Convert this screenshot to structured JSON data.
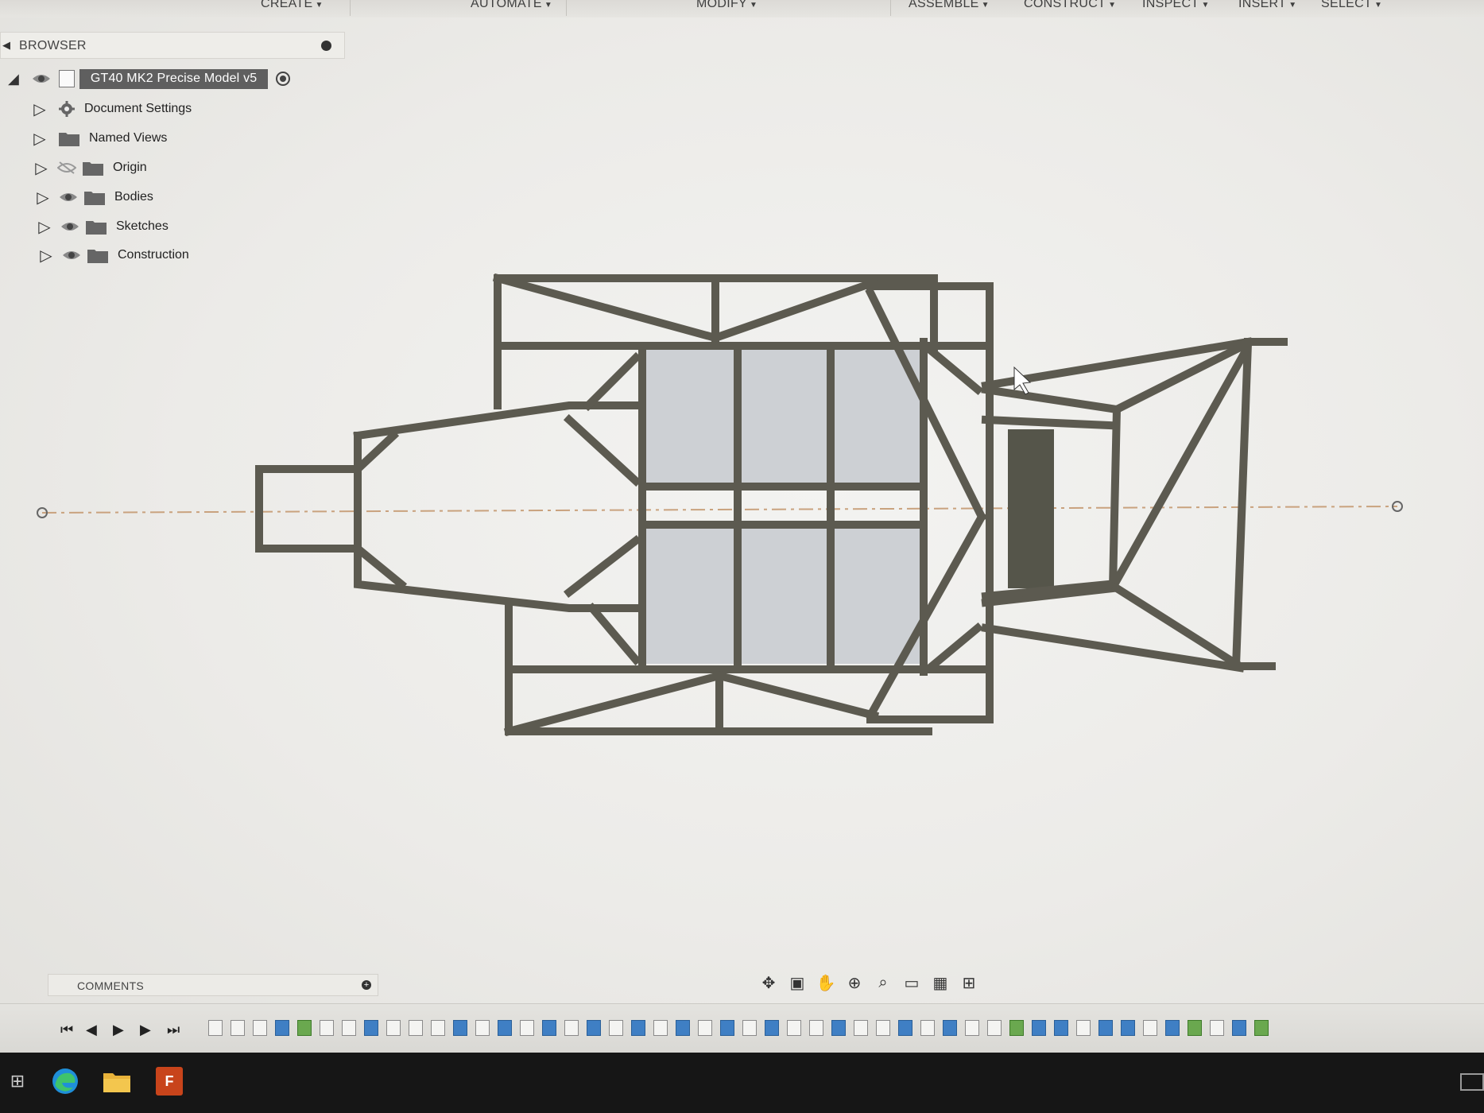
{
  "menubar": {
    "items": [
      {
        "label": "CREATE"
      },
      {
        "label": "AUTOMATE"
      },
      {
        "label": "MODIFY"
      },
      {
        "label": "ASSEMBLE"
      },
      {
        "label": "CONSTRUCT"
      },
      {
        "label": "INSPECT"
      },
      {
        "label": "INSERT"
      },
      {
        "label": "SELECT"
      }
    ]
  },
  "browser": {
    "title": "BROWSER",
    "root": {
      "label": "GT40 MK2 Precise Model v5",
      "icon": "component-icon"
    },
    "items": [
      {
        "label": "Document Settings",
        "icon": "gear-icon",
        "visible": null
      },
      {
        "label": "Named Views",
        "icon": "folder-icon",
        "visible": null
      },
      {
        "label": "Origin",
        "icon": "folder-icon",
        "visible": false
      },
      {
        "label": "Bodies",
        "icon": "folder-icon",
        "visible": true
      },
      {
        "label": "Sketches",
        "icon": "folder-icon",
        "visible": true
      },
      {
        "label": "Construction",
        "icon": "folder-icon",
        "visible": true
      }
    ]
  },
  "comments": {
    "label": "COMMENTS"
  },
  "nav_tools": [
    "orbit-icon",
    "look-at-icon",
    "pan-icon",
    "zoom-icon",
    "fit-icon",
    "display-settings-icon",
    "grid-icon",
    "viewports-icon"
  ],
  "timeline": {
    "controls": [
      "first-icon",
      "previous-icon",
      "play-icon",
      "next-icon",
      "last-icon"
    ]
  },
  "taskbar": {
    "apps": [
      "start-icon",
      "edge-icon",
      "file-explorer-icon",
      "fusion-icon"
    ],
    "fusion_letter": "F"
  },
  "colors": {
    "frame_tube": "#5c5a50",
    "frame_stroke": "#3b3a33",
    "panel_fill": "#cfd2d6",
    "centerline": "#c9a27e",
    "chip_bg": "#5f5f5f"
  }
}
